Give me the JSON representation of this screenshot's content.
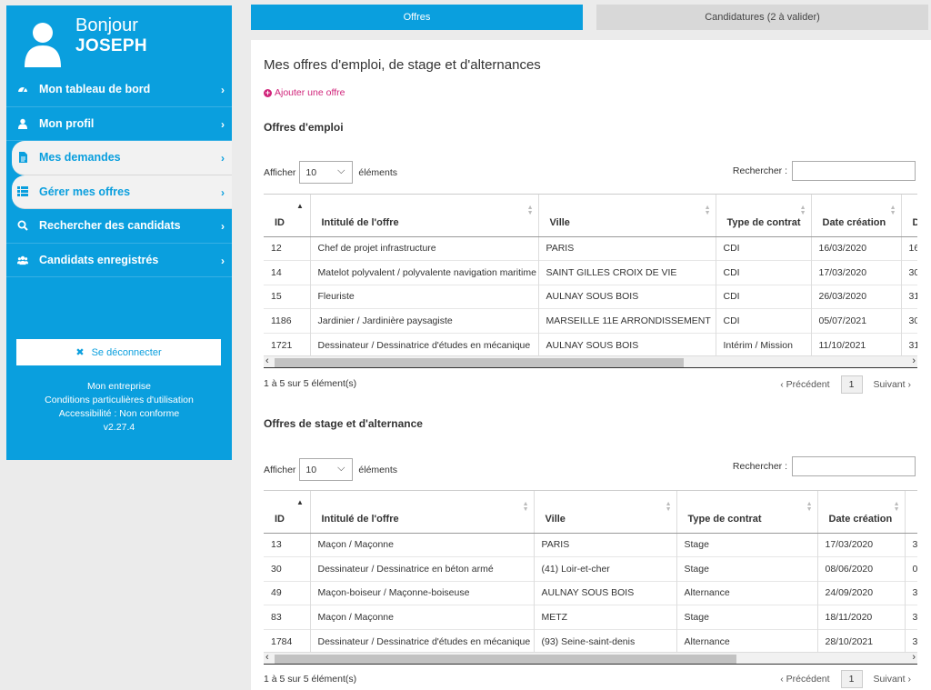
{
  "sidebar": {
    "greeting": "Bonjour",
    "user_name": "JOSEPH",
    "items": [
      {
        "label": "Mon tableau de bord",
        "icon": "dashboard-icon",
        "active": false
      },
      {
        "label": "Mon profil",
        "icon": "user-icon",
        "active": false
      },
      {
        "label": "Mes demandes",
        "icon": "document-icon",
        "active": true
      },
      {
        "label": "Gérer mes offres",
        "icon": "list-icon",
        "active": true
      },
      {
        "label": "Rechercher des candidats",
        "icon": "search-icon",
        "active": false
      },
      {
        "label": "Candidats enregistrés",
        "icon": "users-icon",
        "active": false
      }
    ],
    "logout_label": "Se déconnecter",
    "footer_links": [
      "Mon entreprise",
      "Conditions particulières d'utilisation",
      "Accessibilité : Non conforme",
      "v2.27.4"
    ]
  },
  "tabs": {
    "offres": "Offres",
    "candidatures": "Candidatures (2 à valider)"
  },
  "main": {
    "title": "Mes offres d'emploi, de stage et d'alternances",
    "add_offer": "Ajouter une offre",
    "show_label": "Afficher",
    "show_value": "10",
    "elements_label": "éléments",
    "search_label": "Rechercher :",
    "prev_label": "Précédent",
    "next_label": "Suivant",
    "current_page": "1"
  },
  "jobs": {
    "title": "Offres d'emploi",
    "info": "1 à 5 sur 5 élément(s)",
    "columns": [
      "ID",
      "Intitulé de l'offre",
      "Ville",
      "Type de contrat",
      "Date création",
      "D"
    ],
    "rows": [
      [
        "12",
        "Chef de projet infrastructure",
        "PARIS",
        "CDI",
        "16/03/2020",
        "16"
      ],
      [
        "14",
        "Matelot polyvalent / polyvalente navigation maritime",
        "SAINT GILLES CROIX DE VIE",
        "CDI",
        "17/03/2020",
        "30"
      ],
      [
        "15",
        "Fleuriste",
        "AULNAY SOUS BOIS",
        "CDI",
        "26/03/2020",
        "31"
      ],
      [
        "1186",
        "Jardinier / Jardinière paysagiste",
        "MARSEILLE 11E ARRONDISSEMENT",
        "CDI",
        "05/07/2021",
        "30"
      ],
      [
        "1721",
        "Dessinateur / Dessinatrice d'études en mécanique",
        "AULNAY SOUS BOIS",
        "Intérim / Mission",
        "11/10/2021",
        "31"
      ]
    ]
  },
  "internships": {
    "title": "Offres de stage et d'alternance",
    "info": "1 à 5 sur 5 élément(s)",
    "columns": [
      "ID",
      "Intitulé de l'offre",
      "Ville",
      "Type de contrat",
      "Date création",
      ""
    ],
    "rows": [
      [
        "13",
        "Maçon / Maçonne",
        "PARIS",
        "Stage",
        "17/03/2020",
        "3"
      ],
      [
        "30",
        "Dessinateur / Dessinatrice en béton armé",
        "(41) Loir-et-cher",
        "Stage",
        "08/06/2020",
        "0"
      ],
      [
        "49",
        "Maçon-boiseur / Maçonne-boiseuse",
        "AULNAY SOUS BOIS",
        "Alternance",
        "24/09/2020",
        "3"
      ],
      [
        "83",
        "Maçon / Maçonne",
        "METZ",
        "Stage",
        "18/11/2020",
        "3"
      ],
      [
        "1784",
        "Dessinateur / Dessinatrice d'études en mécanique",
        "(93) Seine-saint-denis",
        "Alternance",
        "28/10/2021",
        "3"
      ]
    ]
  }
}
